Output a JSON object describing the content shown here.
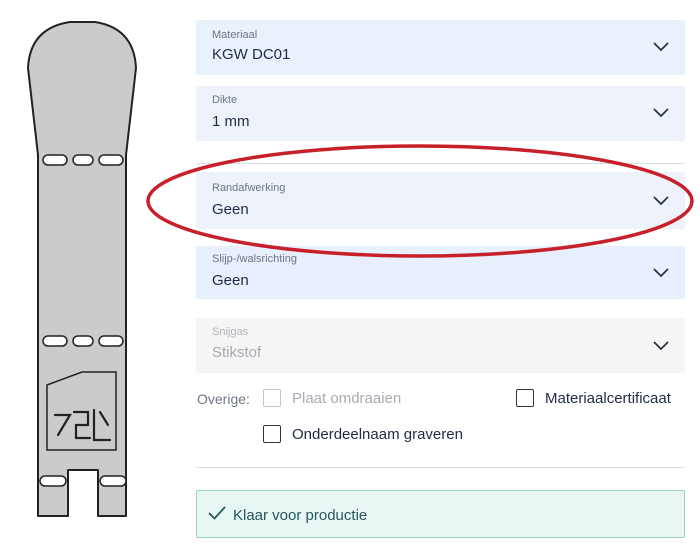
{
  "options": {
    "materiaal": {
      "label": "Materiaal",
      "value": "KGW DC01"
    },
    "dikte": {
      "label": "Dikte",
      "value": "1 mm"
    },
    "randafwerking": {
      "label": "Randafwerking",
      "value": "Geen"
    },
    "slijprichting": {
      "label": "Slijp-/walsrichting",
      "value": "Geen"
    },
    "snijgas": {
      "label": "Snijgas",
      "value": "Stikstof"
    }
  },
  "overige": {
    "label": "Overige:",
    "plaat_omdraaien": "Plaat omdraaien",
    "materiaalcertificaat": "Materiaalcertificaat",
    "onderdeelnaam_graveren": "Onderdeelnaam graveren"
  },
  "status": {
    "message": "Klaar voor productie"
  },
  "colors": {
    "highlight_oval": "#c8202a",
    "select_bg": "#e9f1fc",
    "status_border": "#9fd1c3",
    "status_text": "#24585a"
  }
}
